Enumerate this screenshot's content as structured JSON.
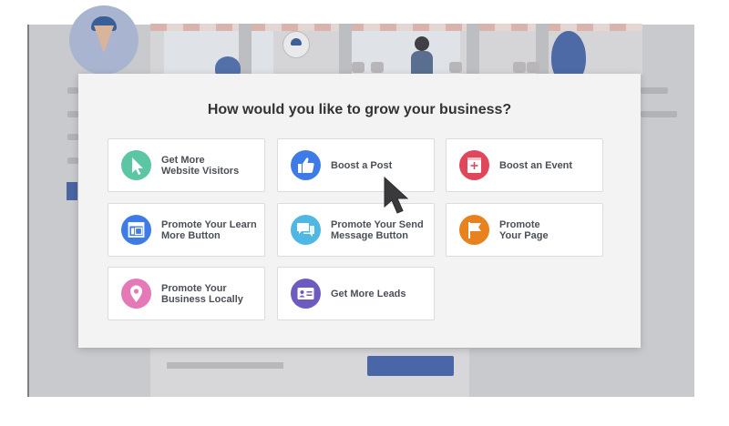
{
  "modal": {
    "title": "How would you like to grow your business?"
  },
  "options": [
    {
      "label": "Get More\nWebsite Visitors",
      "icon": "cursor-pointer-icon",
      "color": "#5cc5a4"
    },
    {
      "label": "Boost a Post",
      "icon": "thumbs-up-icon",
      "color": "#3f7be6"
    },
    {
      "label": "Boost an Event",
      "icon": "calendar-plus-icon",
      "color": "#e1475a"
    },
    {
      "label": "Promote Your Learn\nMore Button",
      "icon": "browser-window-icon",
      "color": "#3f7be6"
    },
    {
      "label": "Promote Your Send\nMessage Button",
      "icon": "chat-bubbles-icon",
      "color": "#4fb7e3"
    },
    {
      "label": "Promote\nYour Page",
      "icon": "flag-icon",
      "color": "#e8821f"
    },
    {
      "label": "Promote Your\nBusiness Locally",
      "icon": "map-pin-icon",
      "color": "#e579b8"
    },
    {
      "label": "Get More Leads",
      "icon": "contact-card-icon",
      "color": "#6d5bc0"
    }
  ]
}
